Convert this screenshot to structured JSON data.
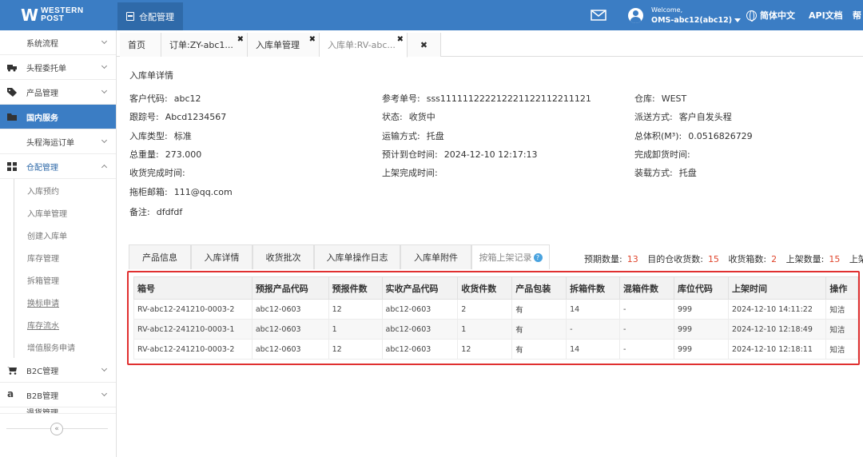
{
  "brand": {
    "logo_mark": "W",
    "line1": "WESTERN",
    "line2": "POST"
  },
  "topnav": {
    "active_label": "仓配管理"
  },
  "user": {
    "welcome": "Welcome,",
    "name": "OMS-abc12(abc12)"
  },
  "header": {
    "language": "简体中文",
    "api": "API文档",
    "help": "帮"
  },
  "sidebar": {
    "items": [
      {
        "label": "系统流程",
        "icon": "none"
      },
      {
        "label": "头程委托单",
        "icon": "truck-icon"
      },
      {
        "label": "产品管理",
        "icon": "tag-icon"
      },
      {
        "label": "国内服务",
        "icon": "folder-icon",
        "active": true
      },
      {
        "label": "头程海运订单",
        "icon": "none"
      },
      {
        "label": "仓配管理",
        "icon": "grid-icon",
        "expanded": true
      },
      {
        "label": "B2C管理",
        "icon": "cart-icon"
      },
      {
        "label": "B2B管理",
        "icon": "amazon-icon"
      },
      {
        "label": "退货管理",
        "icon": "none"
      }
    ],
    "subitems": [
      "入库预约",
      "入库单管理",
      "创建入库单",
      "库存管理",
      "拆箱管理",
      "换标申请",
      "库存流水",
      "增值服务申请"
    ],
    "collapse_glyph": "«"
  },
  "tabs": [
    {
      "label": "首页"
    },
    {
      "label": "订单:ZY-abc1..."
    },
    {
      "label": "入库单管理"
    },
    {
      "label": "入库单:RV-abc..."
    },
    {
      "label": ""
    }
  ],
  "detail": {
    "title": "入库单详情",
    "fields": [
      {
        "label": "客户代码:",
        "value": "abc12"
      },
      {
        "label": "参考单号:",
        "value": "sss111111222212221122112211121"
      },
      {
        "label": "仓库:",
        "value": "WEST"
      },
      {
        "label": "跟踪号:",
        "value": "Abcd1234567"
      },
      {
        "label": "状态:",
        "value": "收货中"
      },
      {
        "label": "派送方式:",
        "value": "客户自发头程"
      },
      {
        "label": "入库类型:",
        "value": "标准"
      },
      {
        "label": "运输方式:",
        "value": "托盘"
      },
      {
        "label": "总体积(M³):",
        "value": "0.0516826729"
      },
      {
        "label": "总重量:",
        "value": "273.000"
      },
      {
        "label": "预计到仓时间:",
        "value": "2024-12-10 12:17:13"
      },
      {
        "label": "完成卸货时间:",
        "value": ""
      },
      {
        "label": "收货完成时间:",
        "value": ""
      },
      {
        "label": "上架完成时间:",
        "value": ""
      },
      {
        "label": "装载方式:",
        "value": "托盘"
      },
      {
        "label": "拖柜邮箱:",
        "value": "111@qq.com"
      },
      {
        "label": "备注:",
        "value": "dfdfdf"
      }
    ]
  },
  "subtabs": [
    "产品信息",
    "入库详情",
    "收货批次",
    "入库单操作日志",
    "入库单附件",
    "按箱上架记录"
  ],
  "stats": [
    {
      "label": "预期数量:",
      "value": "13"
    },
    {
      "label": "目的仓收货数:",
      "value": "15"
    },
    {
      "label": "收货箱数:",
      "value": "2"
    },
    {
      "label": "上架数量:",
      "value": "15"
    },
    {
      "label": "上架箱",
      "value": ""
    }
  ],
  "table": {
    "columns": [
      "箱号",
      "预报产品代码",
      "预报件数",
      "实收产品代码",
      "收货件数",
      "产品包装",
      "拆箱件数",
      "混箱件数",
      "库位代码",
      "上架时间",
      "操作"
    ],
    "rows": [
      [
        "RV-abc12-241210-0003-2",
        "abc12-0603",
        "12",
        "abc12-0603",
        "2",
        "有",
        "14",
        "-",
        "999",
        "2024-12-10 14:11:22",
        "知洁"
      ],
      [
        "RV-abc12-241210-0003-1",
        "abc12-0603",
        "1",
        "abc12-0603",
        "1",
        "有",
        "-",
        "-",
        "999",
        "2024-12-10 12:18:49",
        "知洁"
      ],
      [
        "RV-abc12-241210-0003-2",
        "abc12-0603",
        "12",
        "abc12-0603",
        "12",
        "有",
        "14",
        "-",
        "999",
        "2024-12-10 12:18:11",
        "知洁"
      ]
    ],
    "highlight_color": "#e03030"
  }
}
